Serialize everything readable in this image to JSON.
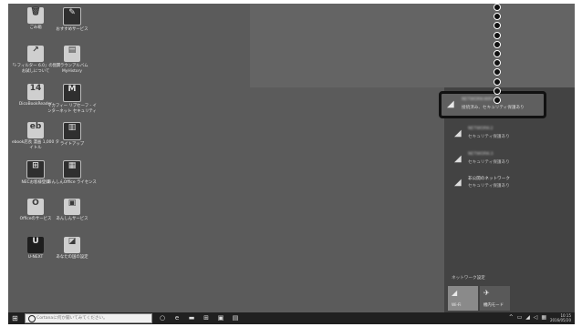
{
  "desktop": {
    "icons": [
      {
        "label": "ごみ箱",
        "glyph": "🗑",
        "style": "light"
      },
      {
        "label": "おすすめサービス",
        "glyph": "✎",
        "style": "dark"
      },
      {
        "label": "「i-フィルター 6.0」の無料 お試しについて",
        "glyph": "↗",
        "style": "light"
      },
      {
        "label": "ブラウンアルバム MyHistory",
        "glyph": "▤",
        "style": "light"
      },
      {
        "label": "DicoBookReader",
        "glyph": "14",
        "style": "light"
      },
      {
        "label": "マカフィー リブセーフ - インターネット セキュリティ",
        "glyph": "M",
        "style": "dark"
      },
      {
        "label": "ebook店長 漫画 1,000 タイトル",
        "glyph": "eb",
        "style": "light"
      },
      {
        "label": "ライトアップ",
        "glyph": "▥",
        "style": "dark"
      },
      {
        "label": "NECお客様登録",
        "glyph": "⊞",
        "style": "dark"
      },
      {
        "label": "あんしんOffice ライセンス",
        "glyph": "▦",
        "style": "dark"
      },
      {
        "label": "Officeのサービス",
        "glyph": "O",
        "style": "light"
      },
      {
        "label": "あんしんサービス",
        "glyph": "▣",
        "style": "light"
      },
      {
        "label": "U-NEXT",
        "glyph": "U",
        "style": "blue"
      },
      {
        "label": "あなたの国の設定",
        "glyph": "◪",
        "style": "light"
      }
    ]
  },
  "network_flyout": {
    "networks": [
      {
        "name": "NETWORK-WIFI",
        "status": "接続済み、セキュリティ保護あり",
        "blurred": true,
        "highlighted": true
      },
      {
        "name": "NETWORK-2",
        "status": "セキュリティ保護あり",
        "blurred": true,
        "highlighted": false
      },
      {
        "name": "NETWORK-3",
        "status": "セキュリティ保護あり",
        "blurred": true,
        "highlighted": false
      },
      {
        "name": "非公開のネットワーク",
        "status": "セキュリティ保護あり",
        "blurred": false,
        "highlighted": false
      }
    ],
    "settings_link": "ネットワーク設定",
    "quick_actions": [
      {
        "label": "Wi-Fi",
        "icon": "wifi-icon",
        "active": true
      },
      {
        "label": "機内モード",
        "icon": "airplane-icon",
        "active": false
      }
    ]
  },
  "taskbar": {
    "search_placeholder": "Cortanaに何か聞いてみてください。",
    "clock_time": "10:15",
    "clock_date": "2016/05/20"
  }
}
